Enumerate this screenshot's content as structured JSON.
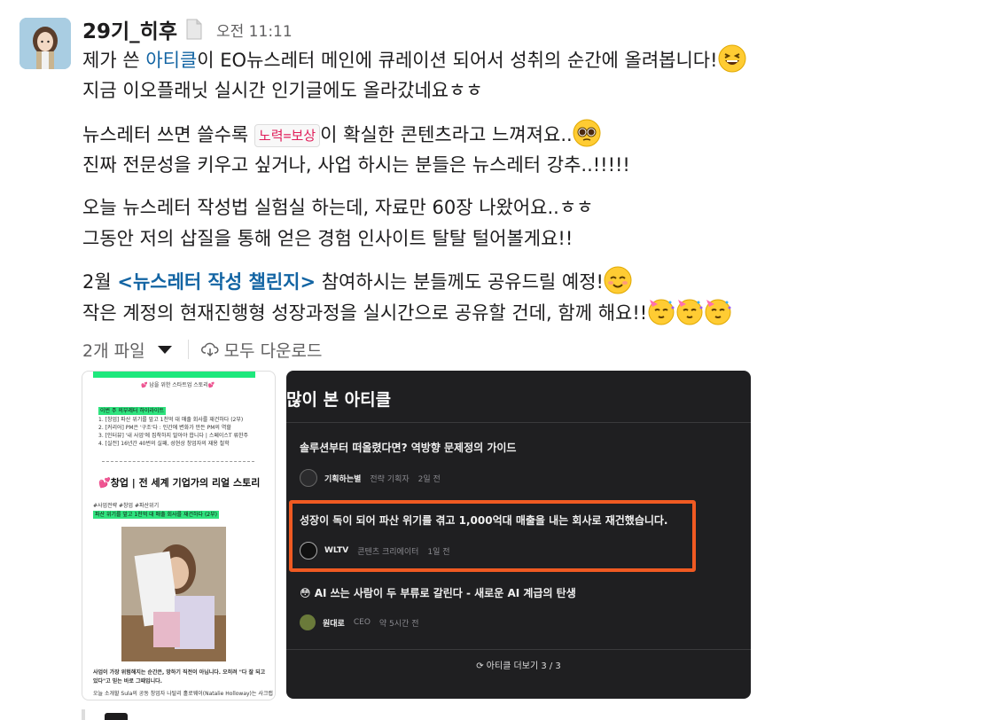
{
  "message": {
    "author": "29기_히후",
    "time": "오전 11:11",
    "status_icon": "page-document-icon",
    "lines": {
      "l1_pre": "제가 쓴 ",
      "l1_link": "아티클",
      "l1_post": "이 EO뉴스레터 메인에 큐레이션 되어서 성취의 순간에 올려봅니다!",
      "l2": "지금 이오플래닛 실시간 인기글에도 올라갔네요ㅎㅎ",
      "l3_pre": "뉴스레터 쓰면 쓸수록 ",
      "l3_code": "노력=보상",
      "l3_post": "이 확실한 콘텐츠라고 느껴져요..",
      "l4": "진짜 전문성을 키우고 싶거나, 사업 하시는 분들은 뉴스레터 강추..!!!!!",
      "l5": "오늘 뉴스레터 작성법 실험실 하는데, 자료만 60장 나왔어요..ㅎㅎ",
      "l6": "그동안 저의 삽질을 통해 얻은 경험 인사이트 탈탈 털어볼게요!!",
      "l7_pre": "2월 ",
      "l7_link": "<뉴스레터 작성 챌린지>",
      "l7_post": " 참여하시는 분들께도 공유드릴 예정!",
      "l8": "작은 계정의 현재진행형 성장과정을 실시간으로 공유할 건데, 함께 해요!!"
    },
    "emojis": [
      "grinning-squinting-face",
      "pleading-face",
      "smiling-face",
      "partying-face"
    ]
  },
  "files": {
    "count_label": "2개 파일",
    "download_all_label": "모두 다운로드"
  },
  "thumb1": {
    "header": "💕 남을 위한 스타트업 스토리💕",
    "section_hl": "이번 주 의부레터 하이라이트",
    "bullets": [
      "1. [창업] 파산 위기를 앞고 1천억 대 매출 회사를 재건하다 (2부)",
      "2. [커리어] PM은 '구조'다 : 인간에 변화가 만든 PM의 역할",
      "3. [인터뷰] '내 사업'에 집착하지 말아야 합니다 | 스페이스T 류한주",
      "4. [실전] 16년간 40번의 실패, 성현상 창업자의 재용 철학"
    ],
    "title": "💕창업 | 전 세계 기업가의 리얼 스토리",
    "tags": "#사업전략 #창업 #파산위기",
    "hl2": "파산 위기를 앞고 1천억 대 매출 회사를 재건하다 (2부)",
    "foot1": "사업이 가장 위험해지는 순간은, 망하기 직전이 아닙니다. 오히려 \"다 잘 되고",
    "foot2": "있다\"고 믿는 바로 그때입니다.",
    "foot3": "오늘 소개할 Sula의 공동 창업자 나탈리 홀로웨이(Natalie Holloway)는 사크랩"
  },
  "thumb2": {
    "title": "많이 본 아티클",
    "articles": [
      {
        "title": "솔루션부터 떠올렸다면? 역방향 문제정의 가이드",
        "author": "기획하는별",
        "role": "전략 기획자",
        "ago": "2일 전"
      },
      {
        "title": "성장이 독이 되어 파산 위기를 겪고 1,000억대 매출을 내는 회사로 재건했습니다.",
        "author": "WLTV",
        "role": "콘텐츠 크리에이터",
        "ago": "1일 전"
      },
      {
        "title": "😳 AI 쓰는 사람이 두 부류로 갈린다 - 새로운 AI 계급의 탄생",
        "author": "원대로",
        "role": "CEO",
        "ago": "약 5시간 전"
      }
    ],
    "more": "아티클 더보기 3 / 3"
  },
  "colors": {
    "link": "#1264a3",
    "code": "#e01e5a",
    "highlight_box": "#f05a22",
    "green_bar": "#1ee87c"
  }
}
